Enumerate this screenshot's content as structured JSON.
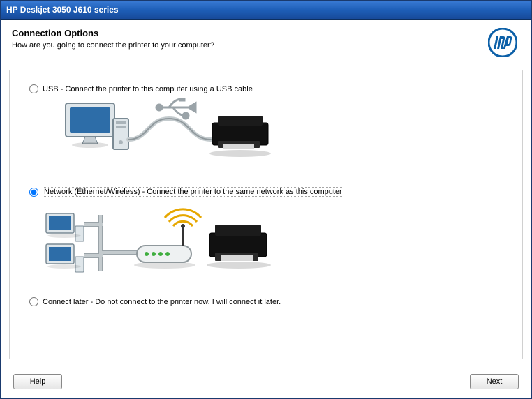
{
  "window": {
    "title": "HP Deskjet 3050 J610 series"
  },
  "header": {
    "title": "Connection Options",
    "subtitle": "How are you going to connect the printer to your computer?"
  },
  "options": {
    "usb": {
      "label": "USB - Connect the printer to this computer using a USB cable",
      "checked": false
    },
    "network": {
      "label": "Network (Ethernet/Wireless) - Connect the printer to the same network as this computer",
      "checked": true
    },
    "later": {
      "label": "Connect later - Do not connect to the printer now. I will connect it later.",
      "checked": false
    }
  },
  "footer": {
    "help_label": "Help",
    "next_label": "Next"
  },
  "logo": {
    "name": "hp"
  }
}
